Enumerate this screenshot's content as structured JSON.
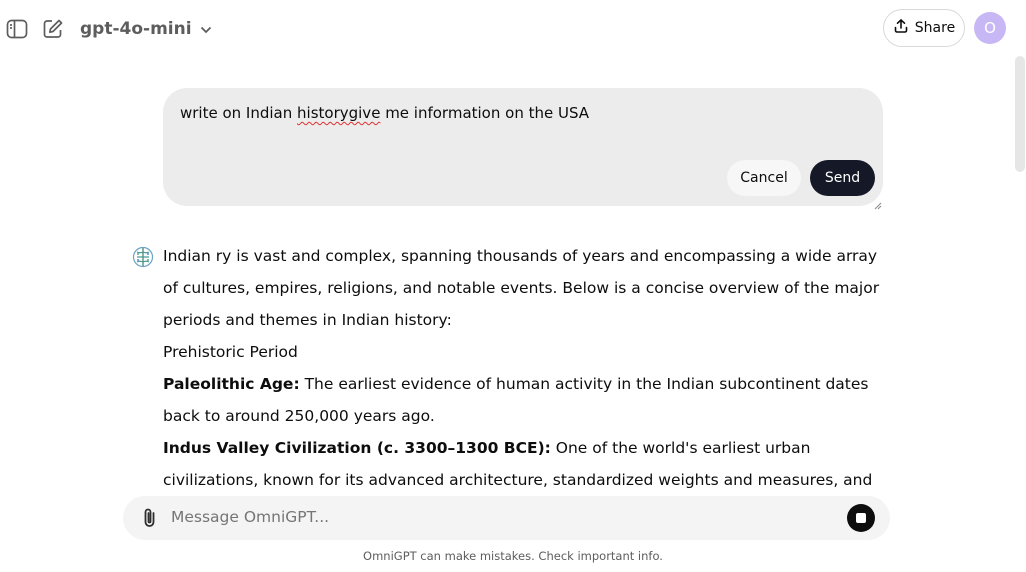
{
  "header": {
    "model_name": "gpt-4o-mini",
    "share_label": "Share",
    "avatar_initial": "O",
    "icons": {
      "sidebar": "sidebar-toggle-icon",
      "new_chat": "edit-icon",
      "model_dropdown": "chevron-down-icon",
      "share": "upload-icon"
    }
  },
  "edit_message": {
    "text_before": "write on Indian ",
    "misspelled_word": "historygive",
    "text_after": " me information on the USA",
    "cancel_label": "Cancel",
    "send_label": "Send"
  },
  "answer": {
    "intro": "Indian ry is vast and complex, spanning thousands of years and encompassing a wide array of cultures, empires, religions, and notable events. Below is a concise overview of the major periods and themes in Indian history:",
    "section_heading": "Prehistoric Period",
    "items": [
      {
        "title": "Paleolithic Age:",
        "body": " The earliest evidence of human activity in the Indian subcontinent dates back to around 250,000 years ago."
      },
      {
        "title": "Indus Valley Civilization (c. 3300–1300 BCE):",
        "body": " One of the world's earliest urban civilizations, known for its advanced architecture, standardized weights and measures, and complex society."
      }
    ]
  },
  "composer": {
    "placeholder": "Message OmniGPT...",
    "attach_icon": "paperclip-icon",
    "stop_icon": "stop-icon"
  },
  "footer": {
    "disclaimer": "OmniGPT can make mistakes. Check important info."
  },
  "colors": {
    "send_button": "#141827",
    "avatar": "#c8b7f5",
    "edit_box": "#ececec",
    "composer": "#f4f4f4"
  }
}
